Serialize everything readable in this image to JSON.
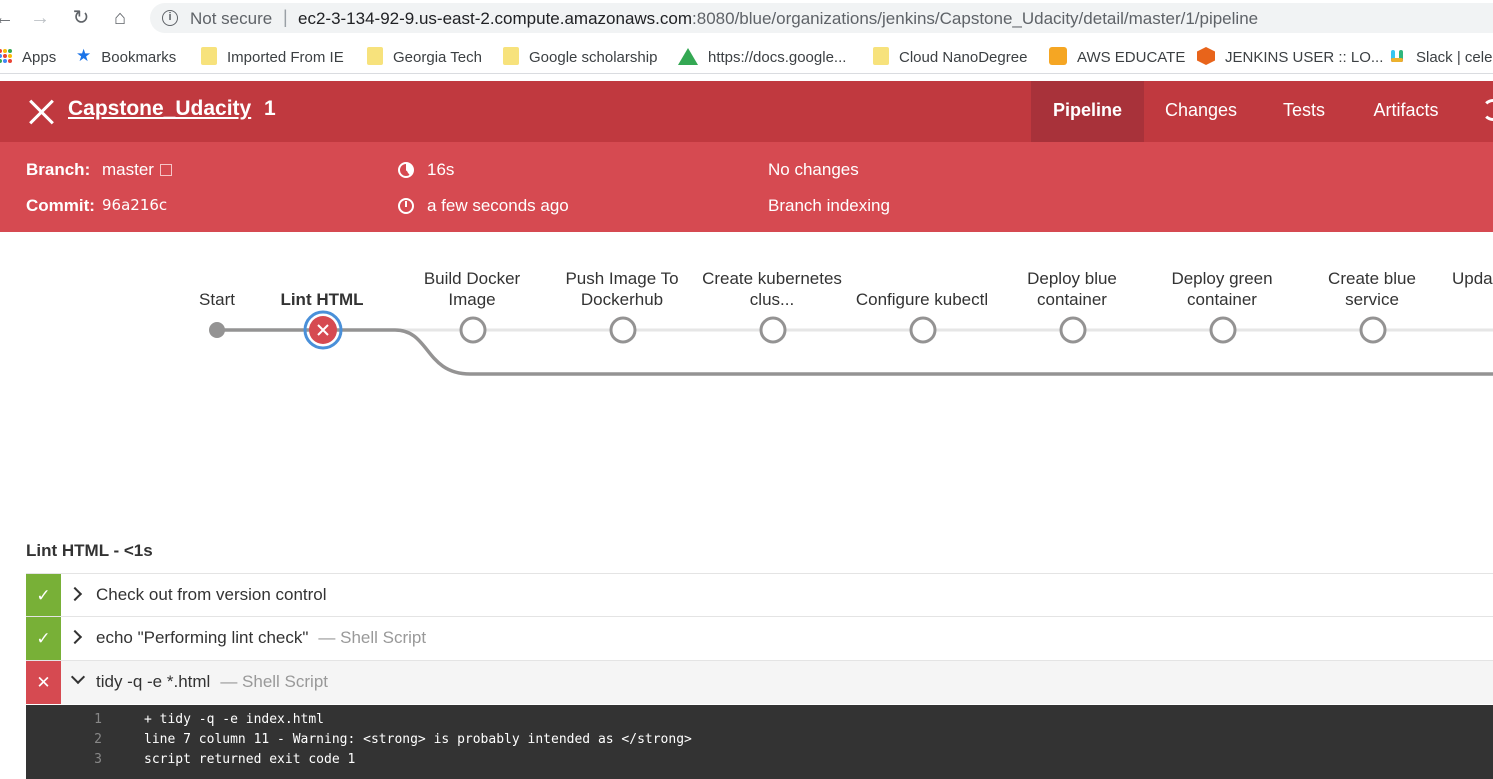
{
  "browser": {
    "security_label": "Not secure",
    "url_host": "ec2-3-134-92-9.us-east-2.compute.amazonaws.com",
    "url_path": ":8080/blue/organizations/jenkins/Capstone_Udacity/detail/master/1/pipeline",
    "bookmarks": [
      {
        "label": "Apps",
        "icon": "apps-grid-icon"
      },
      {
        "label": "Bookmarks",
        "icon": "star-icon"
      },
      {
        "label": "Imported From IE",
        "icon": "folder-icon"
      },
      {
        "label": "Georgia Tech",
        "icon": "folder-icon"
      },
      {
        "label": "Google scholarship",
        "icon": "folder-icon"
      },
      {
        "label": "https://docs.google...",
        "icon": "drive-icon"
      },
      {
        "label": "Cloud NanoDegree",
        "icon": "folder-icon"
      },
      {
        "label": "AWS EDUCATE",
        "icon": "aws-icon"
      },
      {
        "label": "JENKINS USER :: LO...",
        "icon": "jenkins-icon"
      },
      {
        "label": "Slack | celeb",
        "icon": "slack-icon"
      }
    ]
  },
  "run": {
    "job_name": "Capstone_Udacity",
    "run_number": "1",
    "status_color": "#d64a51",
    "tabs": [
      "Pipeline",
      "Changes",
      "Tests",
      "Artifacts"
    ],
    "active_tab": "Pipeline",
    "branch_label": "Branch:",
    "branch": "master",
    "commit_label": "Commit:",
    "commit": "96a216c",
    "duration": "16s",
    "started": "a few seconds ago",
    "changes": "No changes",
    "cause": "Branch indexing"
  },
  "pipeline": {
    "stages": [
      {
        "label": "Start",
        "status": "start"
      },
      {
        "label": "Lint HTML",
        "status": "failed",
        "selected": true
      },
      {
        "label": "Build Docker Image",
        "status": "not-built"
      },
      {
        "label": "Push Image To Dockerhub",
        "status": "not-built"
      },
      {
        "label": "Create kubernetes clus...",
        "status": "not-built"
      },
      {
        "label": "Configure kubectl",
        "status": "not-built"
      },
      {
        "label": "Deploy blue container",
        "status": "not-built"
      },
      {
        "label": "Deploy green container",
        "status": "not-built"
      },
      {
        "label": "Create blue service",
        "status": "not-built"
      },
      {
        "label": "Upda",
        "status": "not-built"
      }
    ]
  },
  "steps": {
    "title": "Lint HTML - <1s",
    "items": [
      {
        "name": "Check out from version control",
        "type": "",
        "status": "success",
        "expanded": false
      },
      {
        "name": "echo \"Performing lint check\"",
        "type": "— Shell Script",
        "status": "success",
        "expanded": false
      },
      {
        "name": "tidy -q -e *.html",
        "type": "— Shell Script",
        "status": "failed",
        "expanded": true
      }
    ],
    "log": [
      {
        "n": "1",
        "text": "+ tidy -q -e index.html"
      },
      {
        "n": "2",
        "text": "line 7 column 11 - Warning: <strong> is probably intended as </strong>"
      },
      {
        "n": "3",
        "text": "script returned exit code 1"
      }
    ]
  },
  "colors": {
    "header_dark": "#c0393f",
    "header_light": "#d64a51",
    "success": "#78b037",
    "failure": "#d64a51",
    "selected_ring": "#4a90d9"
  }
}
